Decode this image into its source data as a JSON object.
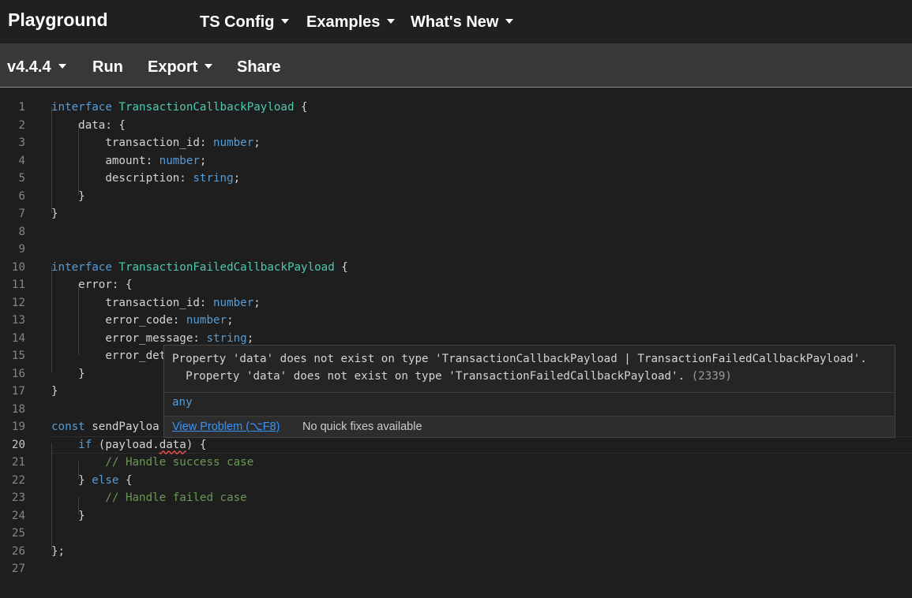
{
  "nav": {
    "brand": "Playground",
    "ts_config": "TS Config",
    "examples": "Examples",
    "whats_new": "What's New"
  },
  "toolbar": {
    "version": "v4.4.4",
    "run": "Run",
    "export": "Export",
    "share": "Share"
  },
  "editor": {
    "active_line": 20,
    "line_numbers": [
      "1",
      "2",
      "3",
      "4",
      "5",
      "6",
      "7",
      "8",
      "9",
      "10",
      "11",
      "12",
      "13",
      "14",
      "15",
      "16",
      "17",
      "18",
      "19",
      "20",
      "21",
      "22",
      "23",
      "24",
      "25",
      "26",
      "27"
    ],
    "lines": [
      [
        {
          "t": "interface ",
          "c": "kw"
        },
        {
          "t": "TransactionCallbackPayload",
          "c": "ty"
        },
        {
          "t": " {"
        }
      ],
      [
        {
          "t": "    data: {"
        }
      ],
      [
        {
          "t": "        transaction_id: "
        },
        {
          "t": "number",
          "c": "kw"
        },
        {
          "t": ";"
        }
      ],
      [
        {
          "t": "        amount: "
        },
        {
          "t": "number",
          "c": "kw"
        },
        {
          "t": ";"
        }
      ],
      [
        {
          "t": "        description: "
        },
        {
          "t": "string",
          "c": "kw"
        },
        {
          "t": ";"
        }
      ],
      [
        {
          "t": "    }"
        }
      ],
      [
        {
          "t": "}"
        }
      ],
      [],
      [],
      [
        {
          "t": "interface ",
          "c": "kw"
        },
        {
          "t": "TransactionFailedCallbackPayload",
          "c": "ty"
        },
        {
          "t": " {"
        }
      ],
      [
        {
          "t": "    error: {"
        }
      ],
      [
        {
          "t": "        transaction_id: "
        },
        {
          "t": "number",
          "c": "kw"
        },
        {
          "t": ";"
        }
      ],
      [
        {
          "t": "        error_code: "
        },
        {
          "t": "number",
          "c": "kw"
        },
        {
          "t": ";"
        }
      ],
      [
        {
          "t": "        error_message: "
        },
        {
          "t": "string",
          "c": "kw"
        },
        {
          "t": ";"
        }
      ],
      [
        {
          "t": "        error_det"
        }
      ],
      [
        {
          "t": "    }"
        }
      ],
      [
        {
          "t": "}"
        }
      ],
      [],
      [
        {
          "t": "const ",
          "c": "kw"
        },
        {
          "t": "sendPayloa"
        }
      ],
      [
        {
          "t": "    "
        },
        {
          "t": "if",
          "c": "kw"
        },
        {
          "t": " (payload."
        },
        {
          "t": "data",
          "c": "squig"
        },
        {
          "t": ") {"
        }
      ],
      [
        {
          "t": "        "
        },
        {
          "t": "// Handle success case",
          "c": "cm"
        }
      ],
      [
        {
          "t": "    } "
        },
        {
          "t": "else",
          "c": "kw"
        },
        {
          "t": " {"
        }
      ],
      [
        {
          "t": "        "
        },
        {
          "t": "// Handle failed case",
          "c": "cm"
        }
      ],
      [
        {
          "t": "    }"
        }
      ],
      [],
      [
        {
          "t": "};"
        }
      ],
      []
    ]
  },
  "hover": {
    "message_line1": "Property 'data' does not exist on type 'TransactionCallbackPayload | TransactionFailedCallbackPayload'.",
    "message_line2": "  Property 'data' does not exist on type 'TransactionFailedCallbackPayload'.",
    "error_code": "(2339)",
    "type_preview": "any",
    "view_problem": "View Problem (⌥F8)",
    "no_quick_fixes": "No quick fixes available"
  }
}
